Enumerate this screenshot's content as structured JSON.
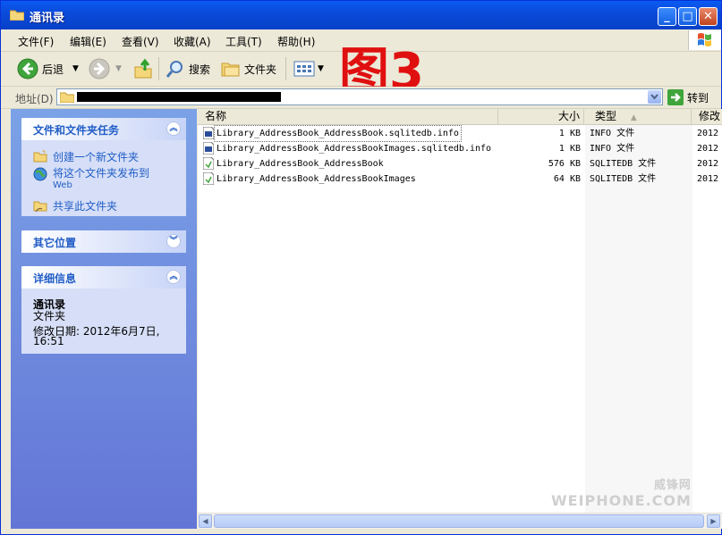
{
  "window": {
    "title": "通讯录"
  },
  "menu": [
    "文件(F)",
    "编辑(E)",
    "查看(V)",
    "收藏(A)",
    "工具(T)",
    "帮助(H)"
  ],
  "toolbar": {
    "back": "后退",
    "search": "搜索",
    "folders": "文件夹"
  },
  "overlay": "图3",
  "address": {
    "label": "地址(D)",
    "value": "",
    "go": "转到"
  },
  "tasks": {
    "title": "文件和文件夹任务",
    "items": [
      "创建一个新文件夹",
      "将这个文件夹发布到",
      "Web",
      "共享此文件夹"
    ]
  },
  "other_places": {
    "title": "其它位置"
  },
  "details": {
    "title": "详细信息",
    "name": "通讯录",
    "kind": "文件夹",
    "modified_line1": "修改日期: 2012年6月7日,",
    "modified_line2": "16:51"
  },
  "columns": {
    "name": "名称",
    "size": "大小",
    "type": "类型",
    "modified": "修改"
  },
  "files": [
    {
      "name": "Library_AddressBook_AddressBook.sqlitedb.info",
      "size": "1 KB",
      "type": "INFO 文件",
      "date": "2012"
    },
    {
      "name": "Library_AddressBook_AddressBookImages.sqlitedb.info",
      "size": "1 KB",
      "type": "INFO 文件",
      "date": "2012"
    },
    {
      "name": "Library_AddressBook_AddressBook",
      "size": "576 KB",
      "type": "SQLITEDB 文件",
      "date": "2012"
    },
    {
      "name": "Library_AddressBook_AddressBookImages",
      "size": "64 KB",
      "type": "SQLITEDB 文件",
      "date": "2012"
    }
  ],
  "watermark": {
    "line1": "威锋网",
    "line2": "WEIPHONE.COM"
  },
  "colors": {
    "title_bar": "#0A5BF2",
    "link": "#215DC6",
    "overlay": "#E01010"
  }
}
